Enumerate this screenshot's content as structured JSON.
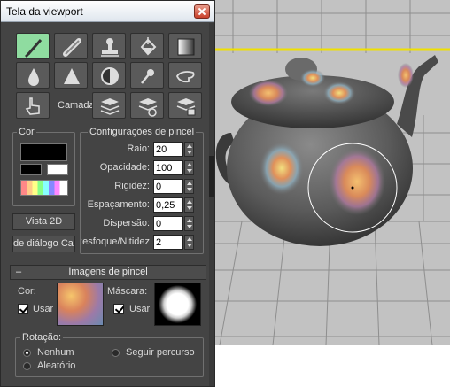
{
  "window": {
    "title": "Tela da viewport"
  },
  "toolbar": {
    "tools": [
      {
        "icon": "paint-brush-icon",
        "active": true
      },
      {
        "icon": "eraser-icon"
      },
      {
        "icon": "stamp-icon"
      },
      {
        "icon": "fill-bucket-icon"
      },
      {
        "icon": "gradient-icon"
      },
      {
        "icon": "blur-drop-icon"
      },
      {
        "icon": "sharpen-triangle-icon"
      },
      {
        "icon": "contrast-icon"
      },
      {
        "icon": "eyedropper-icon"
      },
      {
        "icon": "smudge-hand-icon"
      },
      {
        "icon": "finger-pointer-icon"
      },
      {
        "icon": "add-layer-icon"
      },
      {
        "icon": "layer-refresh-icon"
      },
      {
        "icon": "layer-save-icon"
      }
    ],
    "layer_label": "Camada"
  },
  "color": {
    "label": "Cor",
    "primary": "#000000",
    "secondary": "#000000",
    "tertiary": "#ffffff"
  },
  "view2d_button": "Vista 2D",
  "dialog_button": "de diálogo Car",
  "brush_settings": {
    "label": "Configurações de pincel",
    "fields": [
      {
        "label": "Raio:",
        "value": "20"
      },
      {
        "label": "Opacidade:",
        "value": "100"
      },
      {
        "label": "Rigidez:",
        "value": "0"
      },
      {
        "label": "Espaçamento:",
        "value": "0,25"
      },
      {
        "label": "Dispersão:",
        "value": "0"
      },
      {
        "label": "esfoque/Nitidez:",
        "value": "2"
      }
    ]
  },
  "brush_images": {
    "header": "Imagens de pincel",
    "collapse_symbol": "–",
    "color_label": "Cor:",
    "color_use": "Usar",
    "mask_label": "Máscara:",
    "mask_use": "Usar"
  },
  "rotation": {
    "label": "Rotação:",
    "options": [
      {
        "label": "Nenhum",
        "selected": true
      },
      {
        "label": "Seguir percurso",
        "selected": false
      },
      {
        "label": "Aleatório",
        "selected": false
      }
    ]
  }
}
